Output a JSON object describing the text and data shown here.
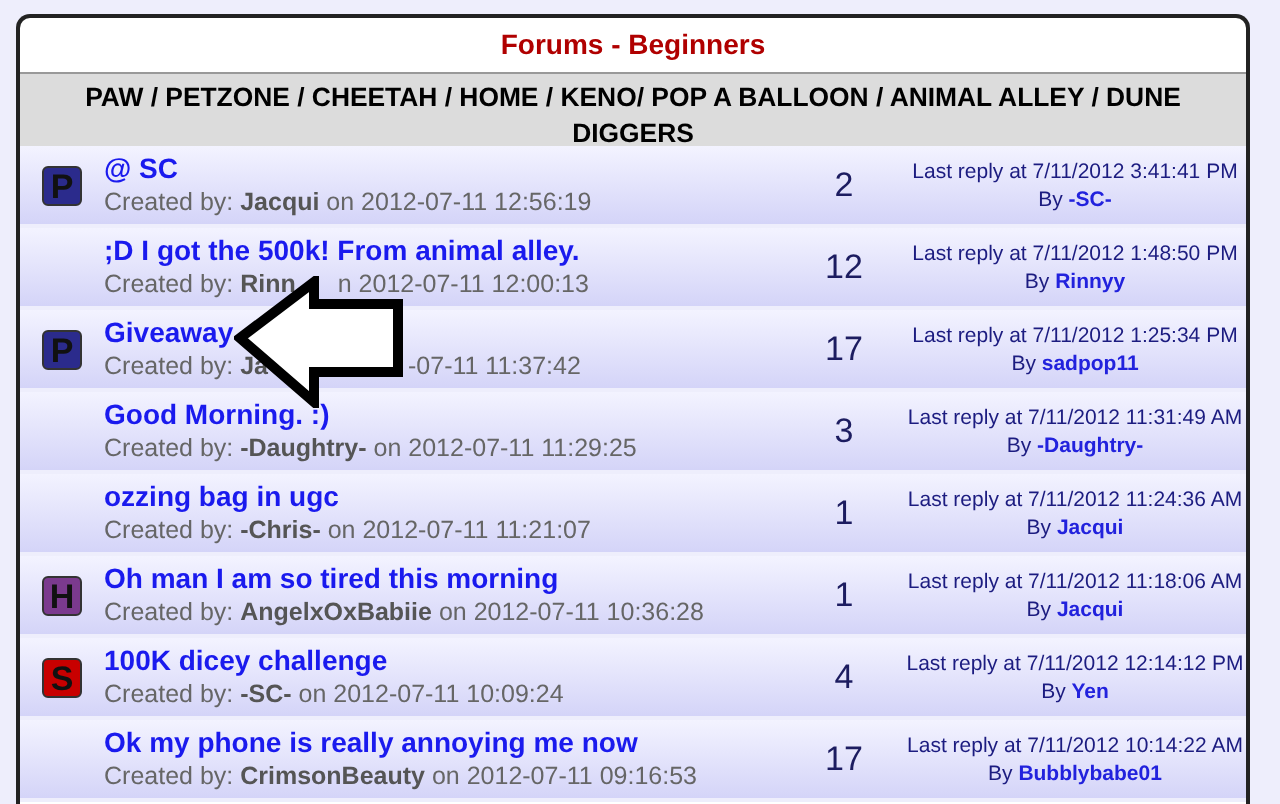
{
  "title": "Forums - Beginners",
  "header": "PAW / PETZONE / CHEETAH / HOME / KENO/ POP A BALLOON / ANIMAL ALLEY / DUNE DIGGERS",
  "topics": [
    {
      "badge": "P",
      "color": "#2b2b8c",
      "title": "@ SC",
      "created_label": "Created by:",
      "author": "Jacqui",
      "on": "on 2012-07-11 12:56:19",
      "replies": "2",
      "last_reply": "Last reply at 7/11/2012 3:41:41 PM",
      "by_label": "By",
      "last_by": "-SC-"
    },
    {
      "title": ";D I got the 500k! From animal alley.",
      "created_label": "Created by:",
      "author": "Rinn",
      "on": "n 2012-07-11 12:00:13",
      "under_arrow_tip": true,
      "replies": "12",
      "last_reply": "Last reply at 7/11/2012 1:48:50 PM",
      "by_label": "By",
      "last_by": "Rinnyy"
    },
    {
      "badge": "P",
      "color": "#2b2b8c",
      "title": "Giveaway",
      "created_label": "Created by:",
      "author": "Ja",
      "on": "-07-11 11:37:42",
      "under_arrow_tail": true,
      "replies": "17",
      "last_reply": "Last reply at 7/11/2012 1:25:34 PM",
      "by_label": "By",
      "last_by": "sadpop11"
    },
    {
      "title": "Good Morning. :)",
      "created_label": "Created by:",
      "author": "-Daughtry-",
      "on": "on 2012-07-11 11:29:25",
      "replies": "3",
      "last_reply": "Last reply at 7/11/2012 11:31:49 AM",
      "by_label": "By",
      "last_by": "-Daughtry-"
    },
    {
      "title": "ozzing bag in ugc",
      "created_label": "Created by:",
      "author": "-Chris-",
      "on": "on 2012-07-11 11:21:07",
      "replies": "1",
      "last_reply": "Last reply at 7/11/2012 11:24:36 AM",
      "by_label": "By",
      "last_by": "Jacqui"
    },
    {
      "badge": "H",
      "color": "#7b3a8e",
      "title": "Oh man I am so tired this morning",
      "created_label": "Created by:",
      "author": "AngelxOxBabiie",
      "on": "on 2012-07-11 10:36:28",
      "replies": "1",
      "last_reply": "Last reply at 7/11/2012 11:18:06 AM",
      "by_label": "By",
      "last_by": "Jacqui"
    },
    {
      "badge": "S",
      "color": "#c80000",
      "title": "100K dicey challenge",
      "created_label": "Created by:",
      "author": "-SC-",
      "on": "on 2012-07-11 10:09:24",
      "replies": "4",
      "last_reply": "Last reply at 7/11/2012 12:14:12 PM",
      "by_label": "By",
      "last_by": "Yen"
    },
    {
      "title": "Ok my phone is really annoying me now",
      "created_label": "Created by:",
      "author": "CrimsonBeauty",
      "on": "on 2012-07-11 09:16:53",
      "replies": "17",
      "last_reply": "Last reply at 7/11/2012 10:14:22 AM",
      "by_label": "By",
      "last_by": "Bubblybabe01"
    }
  ]
}
